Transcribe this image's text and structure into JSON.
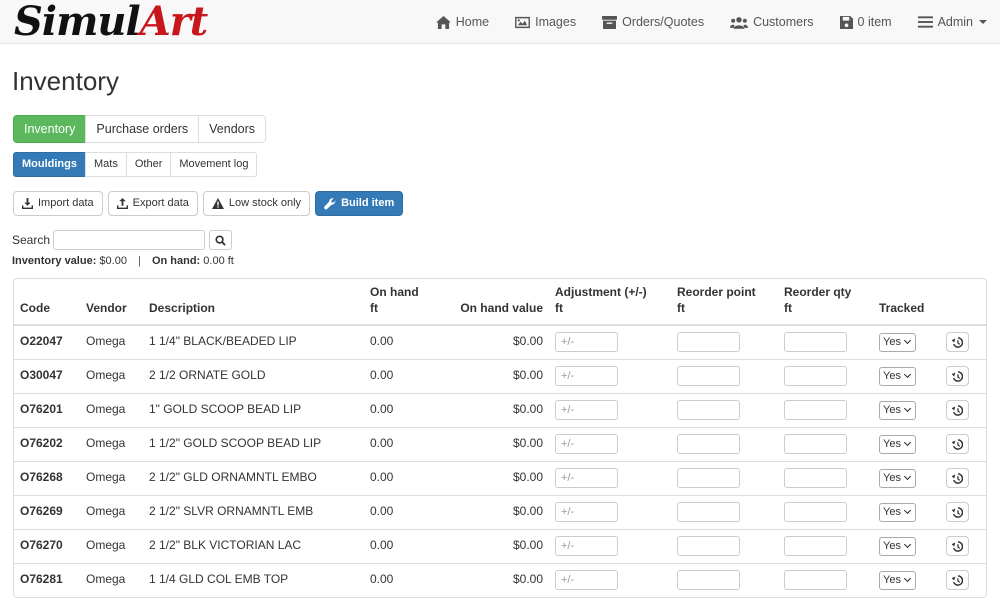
{
  "brand": {
    "part1": "Simul",
    "part2": "Art"
  },
  "nav": [
    {
      "label": "Home",
      "icon": "home-icon"
    },
    {
      "label": "Images",
      "icon": "images-icon"
    },
    {
      "label": "Orders/Quotes",
      "icon": "inbox-icon"
    },
    {
      "label": "Customers",
      "icon": "users-icon"
    },
    {
      "label": "0 item",
      "icon": "cart-icon"
    },
    {
      "label": "Admin",
      "icon": "menu-icon"
    }
  ],
  "page": {
    "title": "Inventory"
  },
  "tabs_primary": [
    "Inventory",
    "Purchase orders",
    "Vendors"
  ],
  "tabs_secondary": [
    "Mouldings",
    "Mats",
    "Other",
    "Movement log"
  ],
  "actions": {
    "import": "Import data",
    "export": "Export data",
    "low_stock": "Low stock only",
    "build": "Build item"
  },
  "search": {
    "label": "Search",
    "value": ""
  },
  "summary": {
    "inventory_label": "Inventory value:",
    "inventory_value": "$0.00",
    "separator": "|",
    "onhand_label": "On hand:",
    "onhand_value": "0.00 ft"
  },
  "table": {
    "headers": {
      "code": "Code",
      "vendor": "Vendor",
      "description": "Description",
      "on_hand_1": "On hand",
      "on_hand_2": "ft",
      "on_hand_value": "On hand value",
      "adjustment_1": "Adjustment (+/-)",
      "adjustment_2": "ft",
      "reorder_point_1": "Reorder point",
      "reorder_point_2": "ft",
      "reorder_qty_1": "Reorder qty",
      "reorder_qty_2": "ft",
      "tracked": "Tracked"
    },
    "adjust_placeholder": "+/-",
    "rows": [
      {
        "code": "O22047",
        "vendor": "Omega",
        "description": "1 1/4\" BLACK/BEADED LIP",
        "on_hand": "0.00",
        "value": "$0.00",
        "tracked": "Yes"
      },
      {
        "code": "O30047",
        "vendor": "Omega",
        "description": "2 1/2 ORNATE GOLD",
        "on_hand": "0.00",
        "value": "$0.00",
        "tracked": "Yes"
      },
      {
        "code": "O76201",
        "vendor": "Omega",
        "description": "1\" GOLD SCOOP BEAD LIP",
        "on_hand": "0.00",
        "value": "$0.00",
        "tracked": "Yes"
      },
      {
        "code": "O76202",
        "vendor": "Omega",
        "description": "1 1/2\" GOLD SCOOP BEAD LIP",
        "on_hand": "0.00",
        "value": "$0.00",
        "tracked": "Yes"
      },
      {
        "code": "O76268",
        "vendor": "Omega",
        "description": "2 1/2\" GLD ORNAMNTL EMBO",
        "on_hand": "0.00",
        "value": "$0.00",
        "tracked": "Yes"
      },
      {
        "code": "O76269",
        "vendor": "Omega",
        "description": "2 1/2\" SLVR ORNAMNTL EMB",
        "on_hand": "0.00",
        "value": "$0.00",
        "tracked": "Yes"
      },
      {
        "code": "O76270",
        "vendor": "Omega",
        "description": "2 1/2\" BLK VICTORIAN LAC",
        "on_hand": "0.00",
        "value": "$0.00",
        "tracked": "Yes"
      },
      {
        "code": "O76281",
        "vendor": "Omega",
        "description": "1 1/4 GLD COL EMB TOP",
        "on_hand": "0.00",
        "value": "$0.00",
        "tracked": "Yes"
      }
    ]
  },
  "colors": {
    "primary": "#337ab7",
    "success": "#5cb85c",
    "brand_red": "#c8161d"
  }
}
